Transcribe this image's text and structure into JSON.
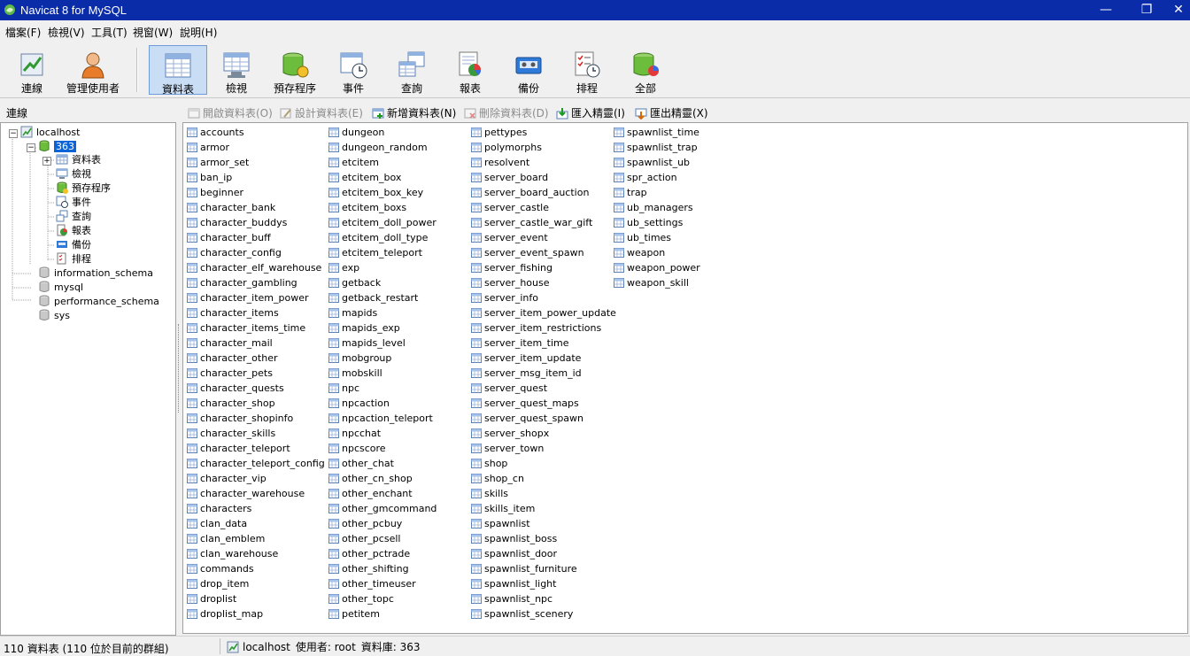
{
  "window": {
    "title": "Navicat 8 for MySQL",
    "minimize": "—",
    "restore": "❐",
    "close": "✕"
  },
  "menu": [
    "檔案(F)",
    "檢視(V)",
    "工具(T)",
    "視窗(W)",
    "說明(H)"
  ],
  "toolbar": [
    {
      "label": "連線",
      "icon": "connection-icon"
    },
    {
      "label": "管理使用者",
      "icon": "user-manager-icon"
    },
    {
      "label": "資料表",
      "icon": "table-icon",
      "active": true
    },
    {
      "label": "檢視",
      "icon": "view-icon"
    },
    {
      "label": "預存程序",
      "icon": "procedure-icon"
    },
    {
      "label": "事件",
      "icon": "event-icon"
    },
    {
      "label": "查詢",
      "icon": "query-icon"
    },
    {
      "label": "報表",
      "icon": "report-icon"
    },
    {
      "label": "備份",
      "icon": "backup-icon"
    },
    {
      "label": "排程",
      "icon": "schedule-icon"
    },
    {
      "label": "全部",
      "icon": "all-icon"
    }
  ],
  "sidebar": {
    "header": "連線",
    "connection": "localhost",
    "selected_db": "363",
    "db_children": [
      "資料表",
      "檢視",
      "預存程序",
      "事件",
      "查詢",
      "報表",
      "備份",
      "排程"
    ],
    "other_dbs": [
      "information_schema",
      "mysql",
      "performance_schema",
      "sys"
    ]
  },
  "actions": [
    {
      "label": "開啟資料表(O)",
      "enabled": false
    },
    {
      "label": "設計資料表(E)",
      "enabled": false
    },
    {
      "label": "新增資料表(N)",
      "enabled": true
    },
    {
      "label": "刪除資料表(D)",
      "enabled": false
    },
    {
      "label": "匯入精靈(I)",
      "enabled": true
    },
    {
      "label": "匯出精靈(X)",
      "enabled": true
    }
  ],
  "tables": [
    [
      "accounts",
      "armor",
      "armor_set",
      "ban_ip",
      "beginner",
      "character_bank",
      "character_buddys",
      "character_buff",
      "character_config",
      "character_elf_warehouse",
      "character_gambling",
      "character_item_power",
      "character_items",
      "character_items_time",
      "character_mail",
      "character_other",
      "character_pets",
      "character_quests",
      "character_shop",
      "character_shopinfo",
      "character_skills",
      "character_teleport",
      "character_teleport_config",
      "character_vip",
      "character_warehouse",
      "characters",
      "clan_data",
      "clan_emblem",
      "clan_warehouse",
      "commands",
      "drop_item",
      "droplist",
      "droplist_map"
    ],
    [
      "dungeon",
      "dungeon_random",
      "etcitem",
      "etcitem_box",
      "etcitem_box_key",
      "etcitem_boxs",
      "etcitem_doll_power",
      "etcitem_doll_type",
      "etcitem_teleport",
      "exp",
      "getback",
      "getback_restart",
      "mapids",
      "mapids_exp",
      "mapids_level",
      "mobgroup",
      "mobskill",
      "npc",
      "npcaction",
      "npcaction_teleport",
      "npcchat",
      "npcscore",
      "other_chat",
      "other_cn_shop",
      "other_enchant",
      "other_gmcommand",
      "other_pcbuy",
      "other_pcsell",
      "other_pctrade",
      "other_shifting",
      "other_timeuser",
      "other_topc",
      "petitem"
    ],
    [
      "pettypes",
      "polymorphs",
      "resolvent",
      "server_board",
      "server_board_auction",
      "server_castle",
      "server_castle_war_gift",
      "server_event",
      "server_event_spawn",
      "server_fishing",
      "server_house",
      "server_info",
      "server_item_power_update",
      "server_item_restrictions",
      "server_item_time",
      "server_item_update",
      "server_msg_item_id",
      "server_quest",
      "server_quest_maps",
      "server_quest_spawn",
      "server_shopx",
      "server_town",
      "shop",
      "shop_cn",
      "skills",
      "skills_item",
      "spawnlist",
      "spawnlist_boss",
      "spawnlist_door",
      "spawnlist_furniture",
      "spawnlist_light",
      "spawnlist_npc",
      "spawnlist_scenery"
    ],
    [
      "spawnlist_time",
      "spawnlist_trap",
      "spawnlist_ub",
      "spr_action",
      "trap",
      "ub_managers",
      "ub_settings",
      "ub_times",
      "weapon",
      "weapon_power",
      "weapon_skill"
    ]
  ],
  "status": {
    "left": "110 資料表 (110 位於目前的群組)",
    "connection": "localhost",
    "user": "使用者: root",
    "database": "資料庫: 363"
  },
  "colors": {
    "titlebar": "#0a2ca8",
    "selection": "#0a64d8",
    "active_tool": "#c9ddf5"
  }
}
